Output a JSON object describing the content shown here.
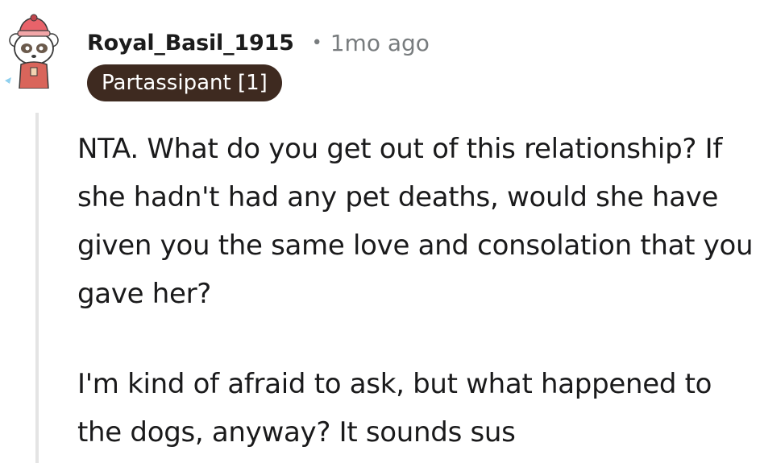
{
  "comment": {
    "author": "Royal_Basil_1915",
    "separator": "•",
    "time_ago": "1mo ago",
    "flair": "Partassipant [1]",
    "avatar_icon": "snoo-avatar-icon",
    "paragraphs": [
      "NTA. What do you get out of this relationship? If she hadn't had any pet deaths, would she have given you the same love and consolation that you gave her?",
      "I'm kind of afraid to ask, but what happened to the dogs, anyway? It sounds sus"
    ]
  },
  "colors": {
    "flair_background": "#3e2a20",
    "flair_text": "#ffffff",
    "meta_gray": "#787c7e",
    "thread_line": "#e4e4e4",
    "avatar_hat": "#e8636a",
    "avatar_shirt": "#d9655b"
  }
}
